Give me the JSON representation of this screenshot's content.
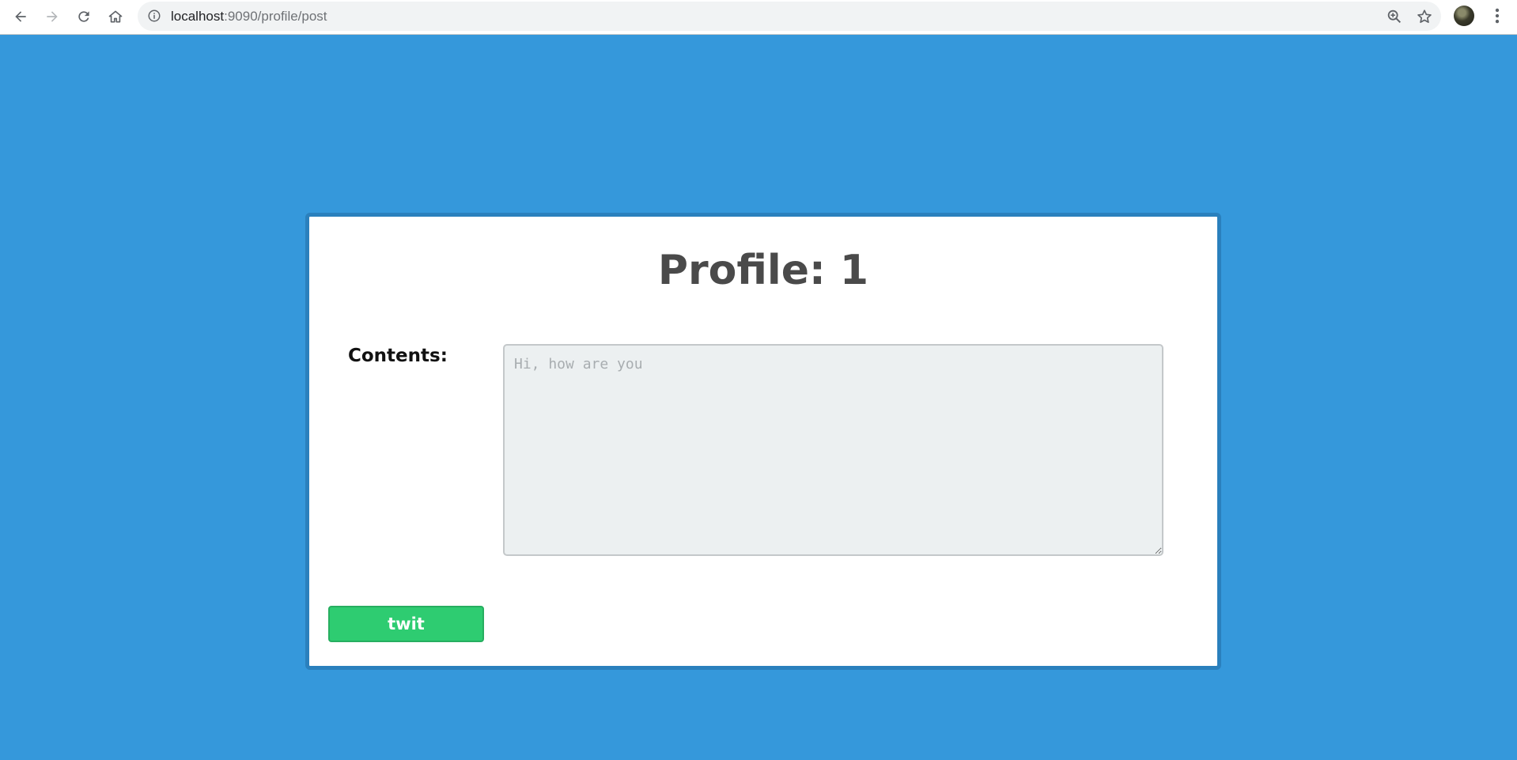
{
  "browser": {
    "url_host": "localhost",
    "url_path": ":9090/profile/post",
    "icons": [
      "back-arrow-icon",
      "forward-arrow-icon",
      "reload-icon",
      "home-icon",
      "info-icon",
      "zoom-icon",
      "star-icon",
      "avatar",
      "menu-icon"
    ]
  },
  "page": {
    "background_color": "#3598db",
    "title": "Profile: 1",
    "form": {
      "contents_label": "Contents:",
      "contents_placeholder": "Hi, how are you",
      "contents_value": "",
      "submit_label": "twit",
      "submit_color": "#2ecc71"
    }
  }
}
